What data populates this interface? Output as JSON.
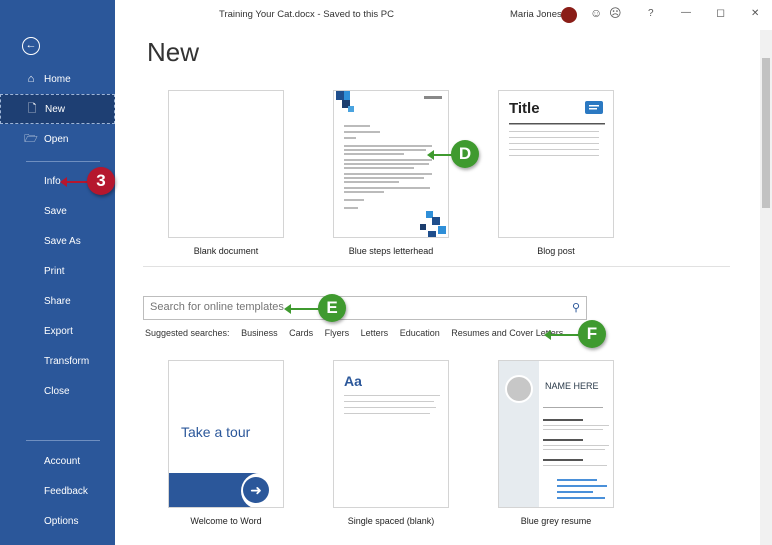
{
  "window": {
    "doc_title": "Training Your Cat.docx  -  Saved to this PC",
    "user_name": "Maria Jones",
    "icons": [
      "smiley-icon",
      "frown-icon",
      "help-icon",
      "minimize-icon",
      "restore-icon",
      "close-icon"
    ],
    "glyphs": {
      "smiley": "☺",
      "frown": "☹",
      "help": "?",
      "minimize": "—",
      "restore": "◻",
      "close": "✕"
    }
  },
  "sidebar": {
    "back": "←",
    "items": [
      {
        "label": "Home",
        "icon": "⌂"
      },
      {
        "label": "New",
        "icon": "🗋"
      },
      {
        "label": "Open",
        "icon": "🗁"
      },
      {
        "label": "Info"
      },
      {
        "label": "Save"
      },
      {
        "label": "Save As"
      },
      {
        "label": "Print"
      },
      {
        "label": "Share"
      },
      {
        "label": "Export"
      },
      {
        "label": "Transform"
      },
      {
        "label": "Close"
      },
      {
        "label": "Account"
      },
      {
        "label": "Feedback"
      },
      {
        "label": "Options"
      }
    ]
  },
  "main": {
    "title": "New",
    "templates_row1": [
      {
        "label": "Blank document"
      },
      {
        "label": "Blue steps letterhead"
      },
      {
        "label": "Blog post",
        "thumb_title": "Title"
      }
    ],
    "search": {
      "placeholder": "Search for online templates",
      "suggest_prefix": "Suggested searches:",
      "suggestions": [
        "Business",
        "Cards",
        "Flyers",
        "Letters",
        "Education",
        "Resumes and Cover Letters"
      ]
    },
    "templates_row2": [
      {
        "label": "Welcome to Word",
        "thumb_text": "Take a tour"
      },
      {
        "label": "Single spaced (blank)",
        "thumb_text": "Aa"
      },
      {
        "label": "Blue grey resume",
        "thumb_text": "NAME HERE"
      }
    ]
  },
  "callouts": {
    "step3": "3",
    "D": "D",
    "E": "E",
    "F": "F"
  },
  "colors": {
    "sidebar": "#2b579a",
    "accent_blue": "#2b579a",
    "callout_red": "#b5172e",
    "callout_green": "#3f9a2f"
  }
}
